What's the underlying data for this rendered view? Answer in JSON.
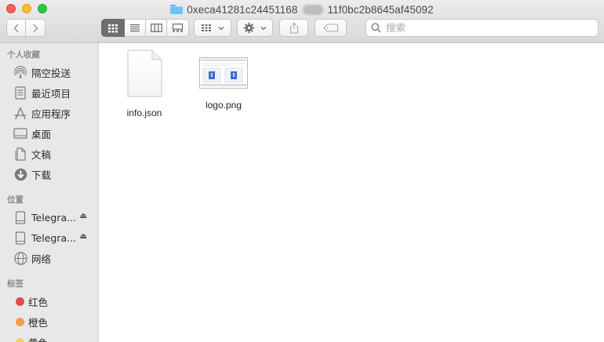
{
  "window": {
    "title_prefix": "0xeca41281c24451168",
    "title_suffix": "11f0bc2b8645af45092"
  },
  "toolbar": {
    "nav": [
      "back-icon",
      "forward-icon"
    ],
    "views": [
      "icon-view-icon",
      "list-view-icon",
      "column-view-icon",
      "gallery-view-icon"
    ],
    "active_view": 0,
    "group_icon": "group-icon",
    "action_icon": "gear-icon",
    "share_icon": "share-icon",
    "tag_icon": "tag-icon",
    "search_placeholder": "搜索"
  },
  "sidebar": {
    "favorites_header": "个人收藏",
    "favorites": [
      {
        "label": "隔空投送",
        "icon": "airdrop-icon"
      },
      {
        "label": "最近项目",
        "icon": "recents-icon"
      },
      {
        "label": "应用程序",
        "icon": "applications-icon"
      },
      {
        "label": "桌面",
        "icon": "desktop-icon"
      },
      {
        "label": "文稿",
        "icon": "documents-icon"
      },
      {
        "label": "下载",
        "icon": "downloads-icon"
      }
    ],
    "locations_header": "位置",
    "locations": [
      {
        "label": "Telegra...",
        "icon": "disk-icon"
      },
      {
        "label": "Telegra...",
        "icon": "disk-icon"
      },
      {
        "label": "网络",
        "icon": "network-icon"
      }
    ],
    "tags_header": "标签",
    "tags": [
      {
        "label": "红色",
        "color": "#e5484d"
      },
      {
        "label": "橙色",
        "color": "#f0a24a"
      },
      {
        "label": "黄色",
        "color": "#f3d24b"
      }
    ]
  },
  "files": [
    {
      "name": "info.json",
      "icon": "document-icon"
    },
    {
      "name": "logo.png",
      "icon": "image-thumbnail-icon"
    }
  ]
}
